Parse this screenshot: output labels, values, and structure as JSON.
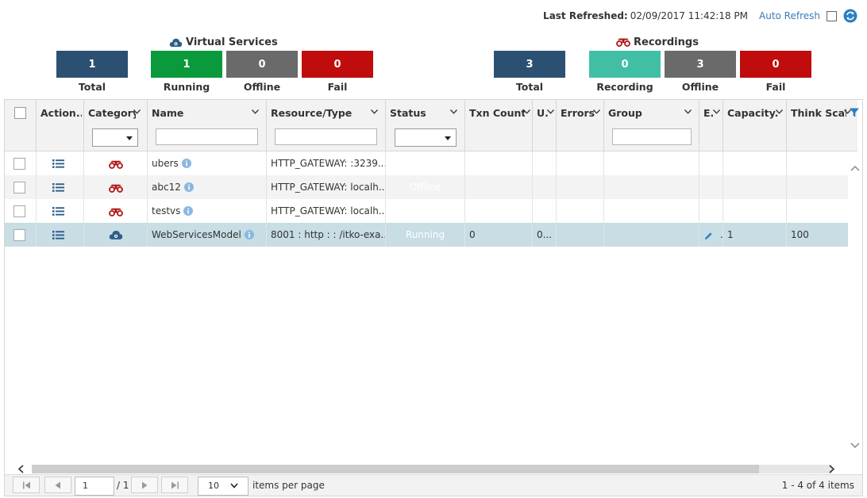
{
  "topbar": {
    "last_refreshed_label": "Last Refreshed:",
    "last_refreshed_value": "02/09/2017 11:42:18 PM",
    "auto_refresh_label": "Auto Refresh"
  },
  "virtual_services": {
    "title": "Virtual Services",
    "stats": [
      {
        "value": "1",
        "label": "Total",
        "color": "#2c5071"
      },
      {
        "value": "1",
        "label": "Running",
        "color": "#0a9a3c"
      },
      {
        "value": "0",
        "label": "Offline",
        "color": "#6a6a6a"
      },
      {
        "value": "0",
        "label": "Fail",
        "color": "#c00c0c"
      }
    ]
  },
  "recordings": {
    "title": "Recordings",
    "stats": [
      {
        "value": "3",
        "label": "Total",
        "color": "#2c5071"
      },
      {
        "value": "0",
        "label": "Recording",
        "color": "#41bfa4"
      },
      {
        "value": "3",
        "label": "Offline",
        "color": "#6a6a6a"
      },
      {
        "value": "0",
        "label": "Fail",
        "color": "#c00c0c"
      }
    ]
  },
  "grid": {
    "columns": [
      "Action...",
      "Category...",
      "Name",
      "Resource/Type",
      "Status",
      "Txn Count...",
      "U...",
      "Errors...",
      "Group",
      "E...",
      "Capacity...",
      "Think Scale..."
    ],
    "rows": [
      {
        "name": "ubers",
        "resource": "HTTP_GATEWAY: :3239...",
        "status": "",
        "txn": "",
        "u": "",
        "capacity": "",
        "think": ""
      },
      {
        "name": "abc12",
        "resource": "HTTP_GATEWAY: localh...",
        "status": "Offline",
        "txn": "",
        "u": "",
        "capacity": "",
        "think": ""
      },
      {
        "name": "testvs",
        "resource": "HTTP_GATEWAY: localh...",
        "status": "",
        "txn": "",
        "u": "",
        "capacity": "",
        "think": ""
      },
      {
        "name": "WebServicesModel",
        "resource": "8001 : http : : /itko-exa...",
        "status": "Running",
        "txn": "0",
        "u": "0...",
        "capacity": "1",
        "think": "100"
      }
    ]
  },
  "pager": {
    "page": "1",
    "of": "/ 1",
    "page_size": "10",
    "items_label": "items per page",
    "info": "1 - 4 of 4 items"
  },
  "colors": {
    "accent": "#3a7ab8",
    "selected_row": "#c8dde4",
    "recording_icon": "#b01616",
    "service_icon": "#2d5d8a"
  }
}
